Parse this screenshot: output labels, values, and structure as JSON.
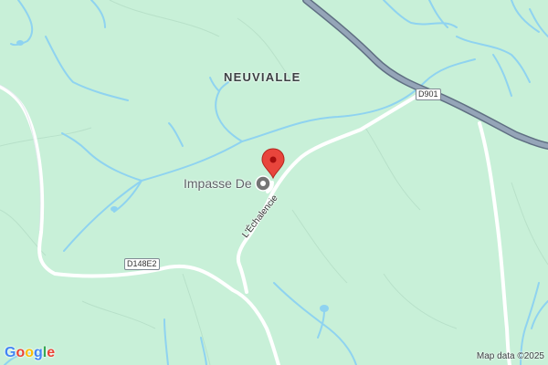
{
  "map": {
    "place_label": "NEUVIALLE",
    "poi_label": "Impasse De",
    "road_label": "L'Échalencie",
    "shields": {
      "d901": "D901",
      "d148e2": "D148E2"
    },
    "attribution": "Map data ©2025",
    "logo": {
      "letters": [
        "G",
        "o",
        "o",
        "g",
        "l",
        "e"
      ]
    }
  },
  "colors": {
    "land": "#c8f0d8",
    "water": "#8fd3f0",
    "minor_road": "#ffffff",
    "major_road": "#8a9bb0",
    "marker": "#e8453c",
    "logo": [
      "#4285F4",
      "#EA4335",
      "#FBBC05",
      "#4285F4",
      "#34A853",
      "#EA4335"
    ]
  },
  "icons": {
    "marker": "map-pin-icon",
    "poi": "poi-icon"
  }
}
